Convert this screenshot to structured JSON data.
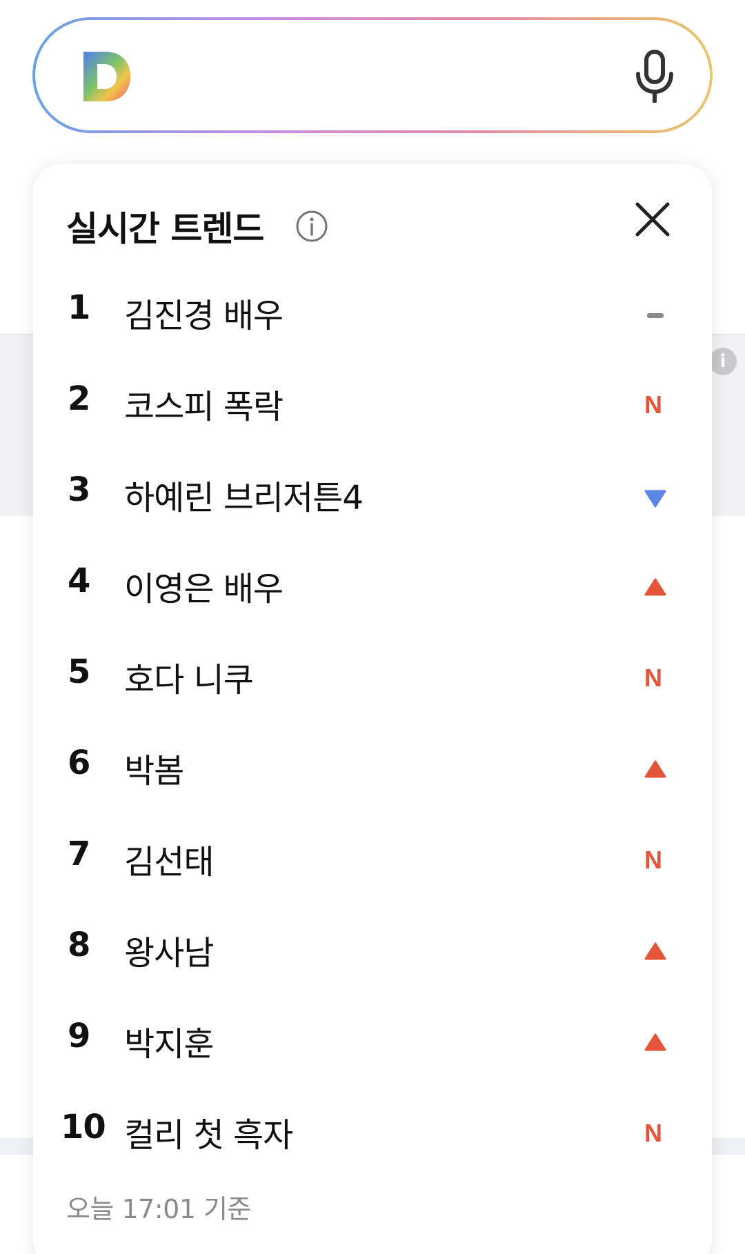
{
  "search": {
    "placeholder": ""
  },
  "panel": {
    "title": "실시간 트렌드",
    "updated_text": "오늘 17:01 기준",
    "items": [
      {
        "rank": "1",
        "keyword": "김진경 배우",
        "status": "same"
      },
      {
        "rank": "2",
        "keyword": "코스피 폭락",
        "status": "new"
      },
      {
        "rank": "3",
        "keyword": "하예린 브리저튼4",
        "status": "down"
      },
      {
        "rank": "4",
        "keyword": "이영은 배우",
        "status": "up"
      },
      {
        "rank": "5",
        "keyword": "호다 니쿠",
        "status": "new"
      },
      {
        "rank": "6",
        "keyword": "박봄",
        "status": "up"
      },
      {
        "rank": "7",
        "keyword": "김선태",
        "status": "new"
      },
      {
        "rank": "8",
        "keyword": "왕사남",
        "status": "up"
      },
      {
        "rank": "9",
        "keyword": "박지훈",
        "status": "up"
      },
      {
        "rank": "10",
        "keyword": "컬리 첫 흑자",
        "status": "new"
      }
    ],
    "new_badge_label": "N"
  },
  "colors": {
    "up": "#e5553a",
    "down": "#5b86e5",
    "same": "#8a8a8e",
    "new": "#e5553a"
  },
  "icons": {
    "logo": "daum-d-logo-icon",
    "mic": "microphone-icon",
    "info": "info-icon",
    "close": "close-icon"
  }
}
